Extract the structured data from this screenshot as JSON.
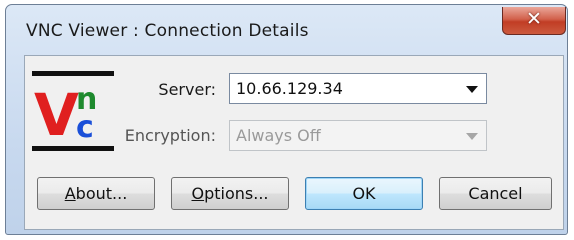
{
  "window": {
    "title": "VNC Viewer : Connection Details",
    "close_label": "✕"
  },
  "logo": {
    "letter_v": "V",
    "letter_n": "n",
    "letter_c": "c"
  },
  "form": {
    "server_label": "Server:",
    "server_value": "10.66.129.34",
    "encryption_label": "Encryption:",
    "encryption_value": "Always Off",
    "encryption_disabled": true
  },
  "buttons": {
    "about_first": "A",
    "about_rest": "bout...",
    "options_first": "O",
    "options_rest": "ptions...",
    "ok": "OK",
    "cancel": "Cancel"
  },
  "colors": {
    "logo_red": "#e01f1f",
    "logo_blue": "#1a4fd8",
    "logo_green": "#1e8a2e",
    "ok_border": "#3c7fb1"
  }
}
